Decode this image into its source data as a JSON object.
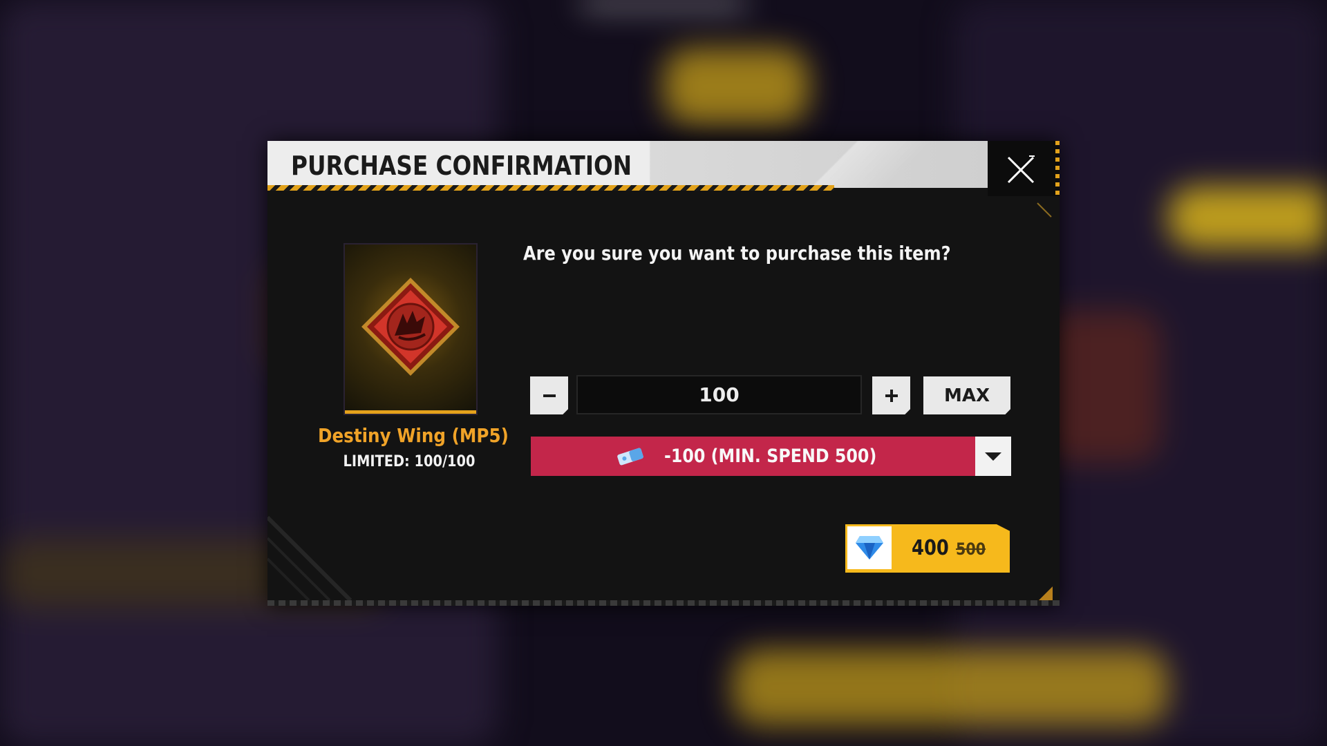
{
  "dialog": {
    "title": "PURCHASE CONFIRMATION",
    "question": "Are you sure you want to purchase this item?"
  },
  "item": {
    "name": "Destiny Wing (MP5)",
    "limit": "LIMITED: 100/100"
  },
  "quantity": {
    "value": "100",
    "max_label": "MAX"
  },
  "voucher": {
    "label": "-100 (MIN. SPEND 500)"
  },
  "price": {
    "current": "400",
    "original": "500"
  },
  "colors": {
    "accent": "#e2a21b",
    "voucher_bg": "#c3264a",
    "price_button": "#f6b91c",
    "item_name": "#f0a328"
  }
}
